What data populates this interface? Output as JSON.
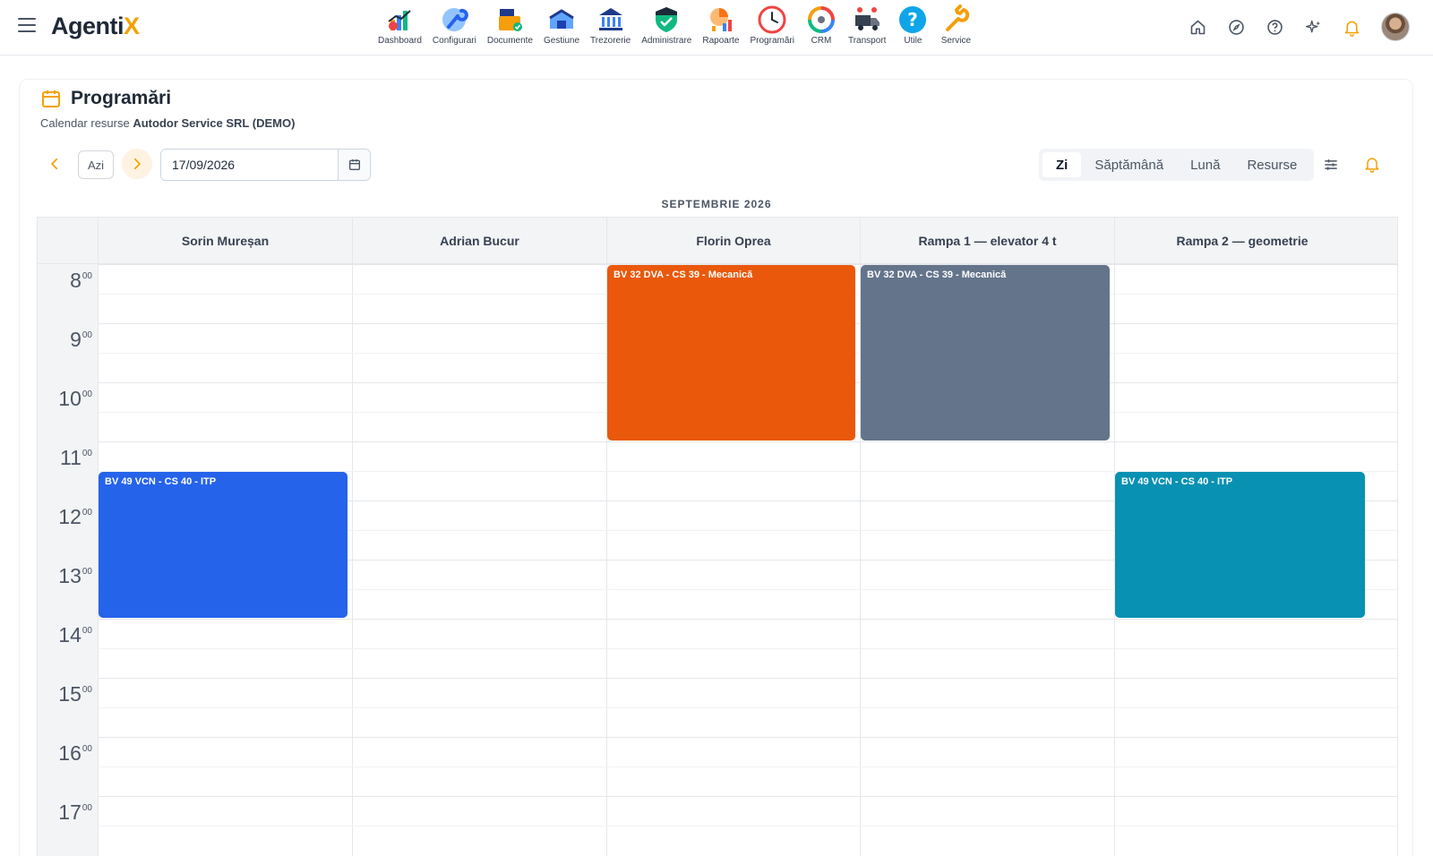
{
  "app": {
    "brand_main": "Agenti",
    "brand_accent": "X"
  },
  "modules": [
    {
      "label": "Dashboard",
      "icon": "dashboard-chart-icon"
    },
    {
      "label": "Configurari",
      "icon": "wrench-gear-icon"
    },
    {
      "label": "Documente",
      "icon": "documents-folder-icon"
    },
    {
      "label": "Gestiune",
      "icon": "warehouse-icon"
    },
    {
      "label": "Trezorerie",
      "icon": "bank-building-icon"
    },
    {
      "label": "Administrare",
      "icon": "shield-check-icon"
    },
    {
      "label": "Rapoarte",
      "icon": "reports-pie-icon"
    },
    {
      "label": "Programări",
      "icon": "clock-icon"
    },
    {
      "label": "CRM",
      "icon": "crm-people-cycle-icon"
    },
    {
      "label": "Transport",
      "icon": "truck-icon"
    },
    {
      "label": "Utile",
      "icon": "help-circle-icon"
    },
    {
      "label": "Service",
      "icon": "wrench-icon"
    }
  ],
  "page": {
    "title": "Programări",
    "subtitle_prefix": "Calendar resurse",
    "company": "Autodor Service SRL (DEMO)"
  },
  "toolbar": {
    "today_label": "Azi",
    "date_value": "17/09/2026",
    "views": [
      "Zi",
      "Săptămână",
      "Lună",
      "Resurse"
    ],
    "active_view": "Zi"
  },
  "calendar": {
    "month_label": "SEPTEMBRIE 2026",
    "hours": [
      "8",
      "9",
      "10",
      "11",
      "12",
      "13",
      "14",
      "15",
      "16",
      "17"
    ],
    "minutes_label": "00",
    "resources": [
      "Sorin Mureșan",
      "Adrian Bucur",
      "Florin Oprea",
      "Rampa 1 — elevator 4 t",
      "Rampa 2 — geometrie"
    ],
    "events": [
      {
        "title": "BV 32 DVA - CS 39 - Mecanică",
        "resource": 2,
        "start": 8,
        "end": 11,
        "color": "#ea580c"
      },
      {
        "title": "BV 32 DVA - CS 39 - Mecanică",
        "resource": 3,
        "start": 8,
        "end": 11,
        "color": "#64748b"
      },
      {
        "title": "BV 49 VCN - CS 40 - ITP",
        "resource": 0,
        "start": 11.5,
        "end": 14,
        "color": "#2563eb"
      },
      {
        "title": "BV 49 VCN - CS 40 - ITP",
        "resource": 4,
        "start": 11.5,
        "end": 14,
        "color": "#0891b2"
      }
    ]
  },
  "colors": {
    "accent": "#f5a000",
    "text": "#1f2937"
  }
}
